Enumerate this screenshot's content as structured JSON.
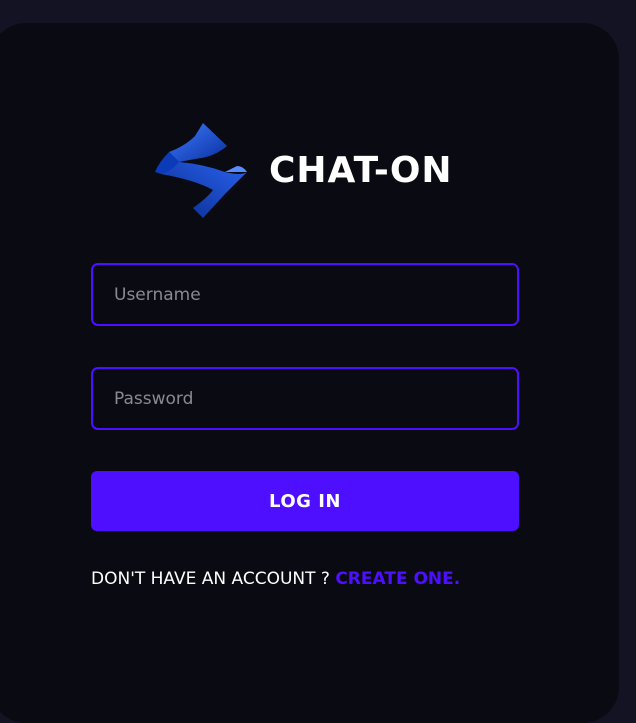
{
  "brand": {
    "name": "CHAT-ON",
    "logo_icon": "folded-ribbon-logo-icon"
  },
  "form": {
    "username_placeholder": "Username",
    "password_placeholder": "Password",
    "login_label": "LOG IN"
  },
  "signup": {
    "prompt": "DON'T HAVE AN ACCOUNT ? ",
    "link_label": "CREATE ONE."
  },
  "colors": {
    "accent": "#4e0eff",
    "page_background": "#131324",
    "card_background": "#0a0b12",
    "logo_blue": "#1f4fd8"
  }
}
